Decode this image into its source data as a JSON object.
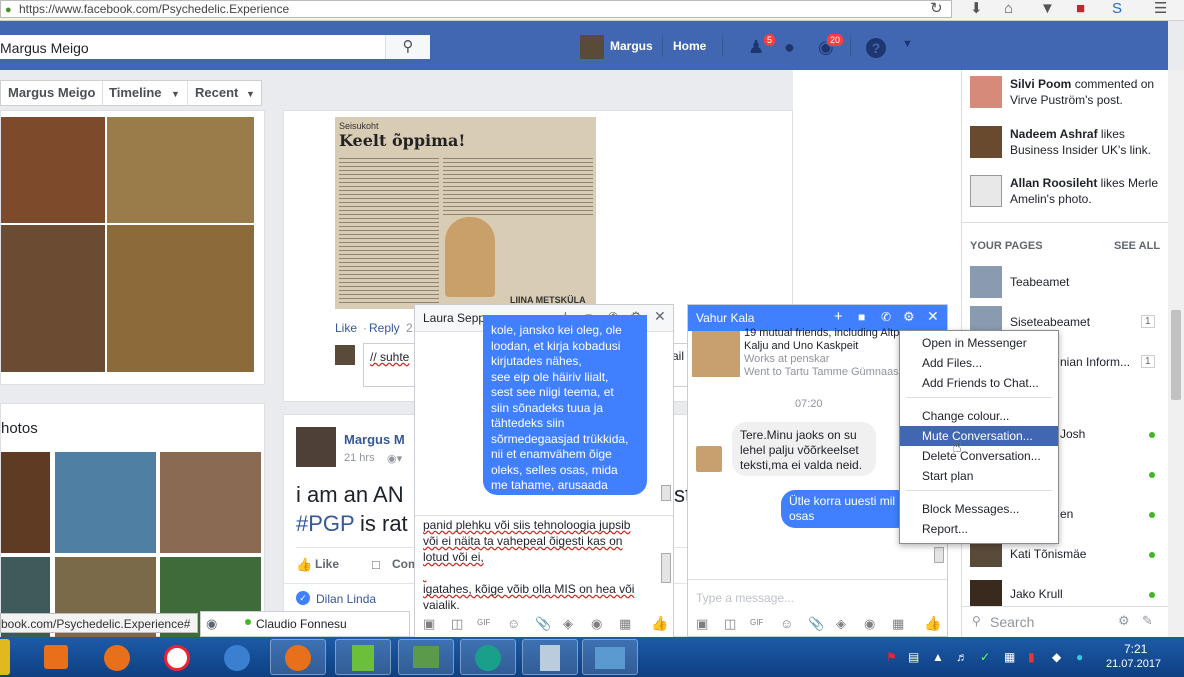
{
  "browser": {
    "url": "https://www.facebook.com/Psychedelic.Experience",
    "status_url": "book.com/Psychedelic.Experience#"
  },
  "fb_bar": {
    "search_value": "Margus Meigo",
    "user_name": "Margus",
    "home_label": "Home",
    "friend_requests_count": "5",
    "notifications_count": "20"
  },
  "profile_tabs": {
    "name": "Margus Meigo",
    "timeline": "Timeline",
    "recent": "Recent"
  },
  "photos_label": "hotos",
  "post_top": {
    "newspaper_heading": "Keelt õppima!",
    "newspaper_kicker": "Seisukoht",
    "newspaper_author": "LIINA METSKÜLA",
    "like": "Like",
    "reply": "Reply",
    "reply_time": "2",
    "comment_preview": "// suhte",
    "comment_tail": "ail"
  },
  "post_main": {
    "author": "Margus M",
    "time": "21 hrs",
    "text_line1": "i am an AN",
    "text_line1_tail": "st",
    "hashtag": "#PGP",
    "text_line2": " is rat",
    "like": "Like",
    "comment": "Com",
    "reactor": "Dilan Linda"
  },
  "chat_laura": {
    "title": "Laura Sepp",
    "msg_top_lines": [
      "kole, jansko kei oleg, ole",
      "loodan, et kirja kobadusi",
      "kirjutades nähes,",
      "see eip ole häiriv liialt,",
      "sest see niigi teema, et",
      "siin sõnadeks tuua ja",
      "tähtedeks siin",
      "sõrmedegaasjad trükkida,",
      "nii et enamvähem õige",
      "oleks, selles osas, mida",
      "me tahame, arusaada"
    ],
    "compose_lines": [
      "panid plehku või siis tehnoloogia jupsib",
      "või ei näita ta vahepeal õigesti kas on",
      "lotud või ei,",
      "",
      "igatahes, kõige võib olla MIS on hea või",
      "vajalik,"
    ]
  },
  "chat_vahur": {
    "title": "Vahur Kala",
    "info_line1": "19 mutual friends, including Altp",
    "info_line2": "Kalju and Uno Kaskpeit",
    "info_line3": "Works at penskar",
    "info_line4": "Went to Tartu Tamme Gümnaasiu",
    "time": "07:20",
    "incoming": [
      "Tere.Minu jaoks on su",
      "lehel palju võõrkeelset",
      "teksti,ma ei valda neid."
    ],
    "outgoing": [
      "Ütle korra uuesti mil",
      "osas"
    ],
    "placeholder": "Type a message..."
  },
  "menu": {
    "items": [
      "Open in Messenger",
      "Add Files...",
      "Add Friends to Chat...",
      "Change colour...",
      "Mute Conversation...",
      "Delete Conversation...",
      "Start plan",
      "Block Messages...",
      "Report..."
    ],
    "highlighted": "Mute Conversation..."
  },
  "right_col": {
    "notifications": [
      {
        "actor": "Silvi Poom",
        "rest": " commented on Virve Puström's post."
      },
      {
        "actor": "Nadeem Ashraf",
        "rest": " likes Business Insider UK's link."
      },
      {
        "actor": "Allan Roosileht",
        "rest": " likes Merle Amelin's photo."
      }
    ],
    "your_pages": "YOUR PAGES",
    "see_all": "SEE ALL",
    "pages": [
      {
        "name": "Teabeamet",
        "count": ""
      },
      {
        "name": "Siseteabeamet",
        "count": "1"
      },
      {
        "name": "nian Inform...",
        "count": "1"
      }
    ],
    "contacts": [
      "Josh",
      "en",
      "Kati Tõnismäe",
      "Jako Krull"
    ],
    "search_placeholder": "Search"
  },
  "bottom_chat_tab": {
    "name": "Claudio Fonnesu"
  },
  "taskbar": {
    "time": "7:21",
    "date": "21.07.2017"
  }
}
